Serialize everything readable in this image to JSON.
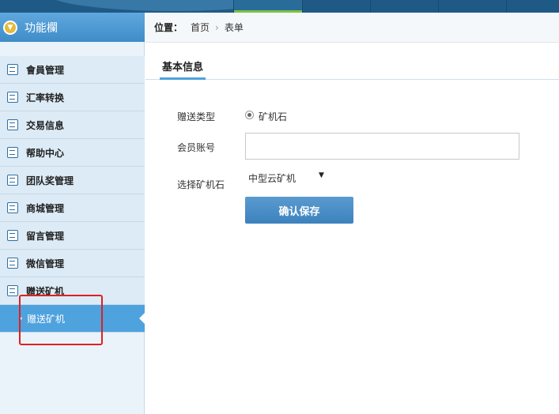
{
  "sidebar": {
    "header_label": "功能欄",
    "items": [
      {
        "label": "會員管理",
        "icon": "list-icon"
      },
      {
        "label": "汇率转换",
        "icon": "chat-icon"
      },
      {
        "label": "交易信息",
        "icon": "list-icon"
      },
      {
        "label": "帮助中心",
        "icon": "edit-icon"
      },
      {
        "label": "团队奖管理",
        "icon": "calendar-icon"
      },
      {
        "label": "商城管理",
        "icon": "calendar-icon"
      },
      {
        "label": "留言管理",
        "icon": "edit-icon"
      },
      {
        "label": "微信管理",
        "icon": "chat-icon"
      },
      {
        "label": "赠送矿机",
        "icon": "chat-icon"
      }
    ],
    "active_item": {
      "label": "赠送矿机"
    }
  },
  "breadcrumb": {
    "label": "位置：",
    "home": "首页",
    "separator": "›",
    "current": "表单"
  },
  "tab": {
    "label": "基本信息"
  },
  "form": {
    "type_label": "赠送类型",
    "type_option": "矿机石",
    "account_label": "会员账号",
    "account_value": "",
    "select_label": "选择矿机石",
    "select_value": "中型云矿机",
    "save_label": "确认保存"
  },
  "colors": {
    "topbar": "#1f5a86",
    "sidebar_header": "#4e9ad6",
    "active_item": "#4ea2dd",
    "save_button": "#4a8dc6",
    "highlight": "#e02020"
  }
}
